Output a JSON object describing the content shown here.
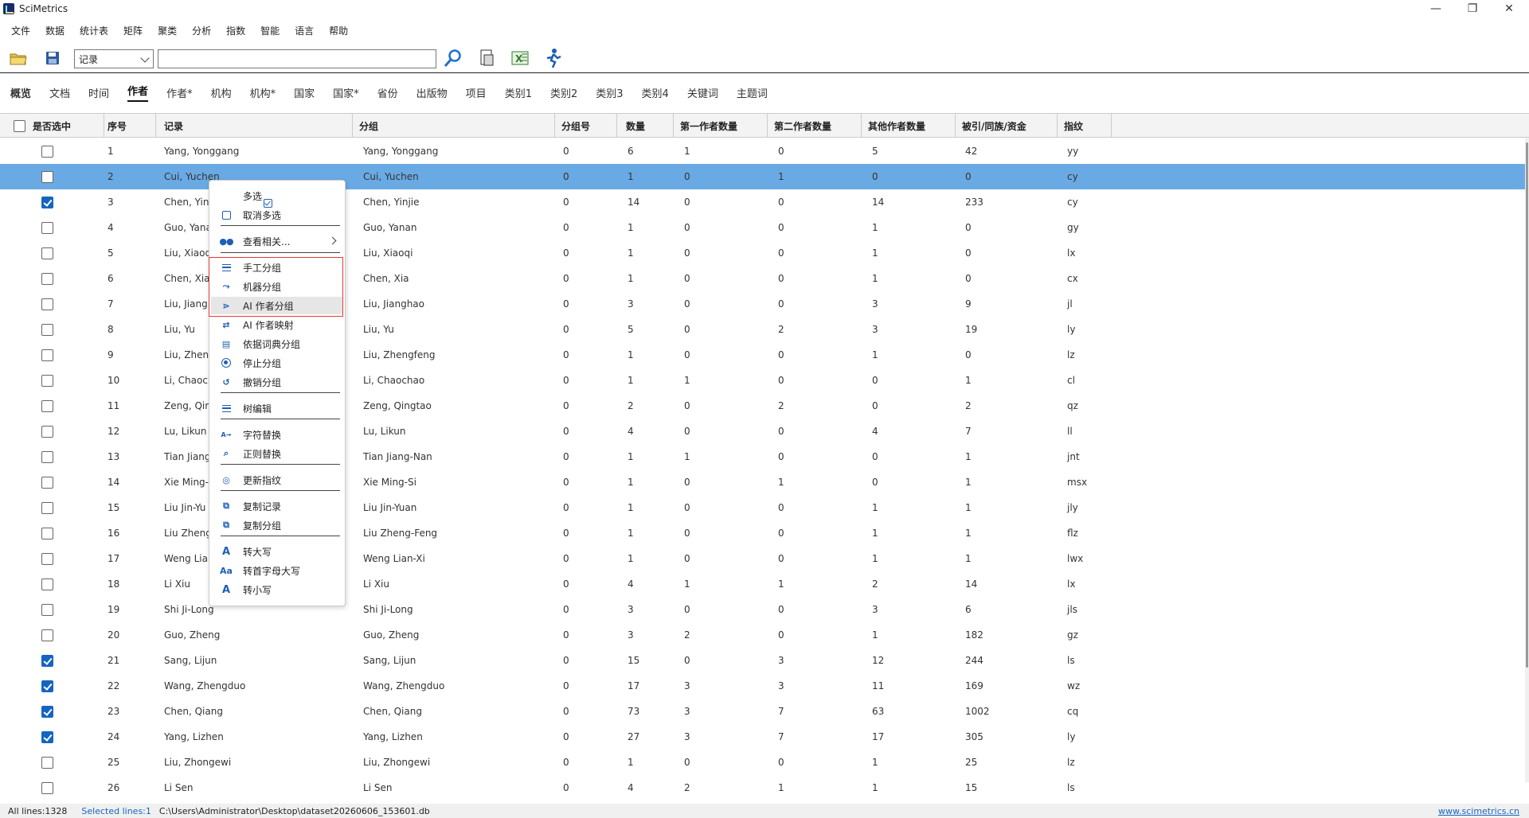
{
  "app": {
    "title": "SciMetrics"
  },
  "window_controls": {
    "minimize": "—",
    "maximize": "❐",
    "close": "✕"
  },
  "menu": [
    "文件",
    "数据",
    "统计表",
    "矩阵",
    "聚类",
    "分析",
    "指数",
    "智能",
    "语言",
    "帮助"
  ],
  "toolbar": {
    "combo_value": "记录",
    "search_value": ""
  },
  "tabs": [
    {
      "label": "概览",
      "style": "bold"
    },
    {
      "label": "文档"
    },
    {
      "label": "时间"
    },
    {
      "label": "作者",
      "style": "active"
    },
    {
      "label": "作者*"
    },
    {
      "label": "机构"
    },
    {
      "label": "机构*"
    },
    {
      "label": "国家"
    },
    {
      "label": "国家*"
    },
    {
      "label": "省份"
    },
    {
      "label": "出版物"
    },
    {
      "label": "项目"
    },
    {
      "label": "类别1"
    },
    {
      "label": "类别2"
    },
    {
      "label": "类别3"
    },
    {
      "label": "类别4"
    },
    {
      "label": "关键词"
    },
    {
      "label": "主题词"
    }
  ],
  "table": {
    "columns": [
      "是否选中",
      "序号",
      "记录",
      "分组",
      "分组号",
      "数量",
      "第一作者数量",
      "第二作者数量",
      "其他作者数量",
      "被引/同族/资金",
      "指纹"
    ],
    "rows": [
      {
        "checked": false,
        "seq": "1",
        "record": "Yang, Yonggang",
        "group": "Yang, Yonggang",
        "gid": "0",
        "count": "6",
        "first": "1",
        "second": "0",
        "other": "5",
        "cited": "42",
        "fp": "yy"
      },
      {
        "checked": false,
        "seq": "2",
        "record": "Cui, Yuchen",
        "group": "Cui, Yuchen",
        "gid": "0",
        "count": "1",
        "first": "0",
        "second": "1",
        "other": "0",
        "cited": "0",
        "fp": "cy",
        "selected": true
      },
      {
        "checked": true,
        "seq": "3",
        "record": "Chen, Yin",
        "group": "Chen, Yinjie",
        "gid": "0",
        "count": "14",
        "first": "0",
        "second": "0",
        "other": "14",
        "cited": "233",
        "fp": "cy"
      },
      {
        "checked": false,
        "seq": "4",
        "record": "Guo, Yana",
        "group": "Guo, Yanan",
        "gid": "0",
        "count": "1",
        "first": "0",
        "second": "0",
        "other": "1",
        "cited": "0",
        "fp": "gy"
      },
      {
        "checked": false,
        "seq": "5",
        "record": "Liu, Xiaoq",
        "group": "Liu, Xiaoqi",
        "gid": "0",
        "count": "1",
        "first": "0",
        "second": "0",
        "other": "1",
        "cited": "0",
        "fp": "lx"
      },
      {
        "checked": false,
        "seq": "6",
        "record": "Chen, Xia",
        "group": "Chen, Xia",
        "gid": "0",
        "count": "1",
        "first": "0",
        "second": "0",
        "other": "1",
        "cited": "0",
        "fp": "cx"
      },
      {
        "checked": false,
        "seq": "7",
        "record": "Liu, Jiang",
        "group": "Liu, Jianghao",
        "gid": "0",
        "count": "3",
        "first": "0",
        "second": "0",
        "other": "3",
        "cited": "9",
        "fp": "jl"
      },
      {
        "checked": false,
        "seq": "8",
        "record": "Liu, Yu",
        "group": "Liu, Yu",
        "gid": "0",
        "count": "5",
        "first": "0",
        "second": "2",
        "other": "3",
        "cited": "19",
        "fp": "ly"
      },
      {
        "checked": false,
        "seq": "9",
        "record": "Liu, Zheng",
        "group": "Liu, Zhengfeng",
        "gid": "0",
        "count": "1",
        "first": "0",
        "second": "0",
        "other": "1",
        "cited": "0",
        "fp": "lz"
      },
      {
        "checked": false,
        "seq": "10",
        "record": "Li, Chaoch",
        "group": "Li, Chaochao",
        "gid": "0",
        "count": "1",
        "first": "1",
        "second": "0",
        "other": "0",
        "cited": "1",
        "fp": "cl"
      },
      {
        "checked": false,
        "seq": "11",
        "record": "Zeng, Qin",
        "group": "Zeng, Qingtao",
        "gid": "0",
        "count": "2",
        "first": "0",
        "second": "2",
        "other": "0",
        "cited": "2",
        "fp": "qz"
      },
      {
        "checked": false,
        "seq": "12",
        "record": "Lu, Likun",
        "group": "Lu, Likun",
        "gid": "0",
        "count": "4",
        "first": "0",
        "second": "0",
        "other": "4",
        "cited": "7",
        "fp": "ll"
      },
      {
        "checked": false,
        "seq": "13",
        "record": "Tian Jiang",
        "group": "Tian Jiang-Nan",
        "gid": "0",
        "count": "1",
        "first": "1",
        "second": "0",
        "other": "0",
        "cited": "1",
        "fp": "jnt"
      },
      {
        "checked": false,
        "seq": "14",
        "record": "Xie Ming-",
        "group": "Xie Ming-Si",
        "gid": "0",
        "count": "1",
        "first": "0",
        "second": "1",
        "other": "0",
        "cited": "1",
        "fp": "msx"
      },
      {
        "checked": false,
        "seq": "15",
        "record": "Liu Jin-Yu",
        "group": "Liu Jin-Yuan",
        "gid": "0",
        "count": "1",
        "first": "0",
        "second": "0",
        "other": "1",
        "cited": "1",
        "fp": "jly"
      },
      {
        "checked": false,
        "seq": "16",
        "record": "Liu Zheng",
        "group": "Liu Zheng-Feng",
        "gid": "0",
        "count": "1",
        "first": "0",
        "second": "0",
        "other": "1",
        "cited": "1",
        "fp": "flz"
      },
      {
        "checked": false,
        "seq": "17",
        "record": "Weng Lian",
        "group": "Weng Lian-Xi",
        "gid": "0",
        "count": "1",
        "first": "0",
        "second": "0",
        "other": "1",
        "cited": "1",
        "fp": "lwx"
      },
      {
        "checked": false,
        "seq": "18",
        "record": "Li Xiu",
        "group": "Li Xiu",
        "gid": "0",
        "count": "4",
        "first": "1",
        "second": "1",
        "other": "2",
        "cited": "14",
        "fp": "lx"
      },
      {
        "checked": false,
        "seq": "19",
        "record": "Shi Ji-Long",
        "group": "Shi Ji-Long",
        "gid": "0",
        "count": "3",
        "first": "0",
        "second": "0",
        "other": "3",
        "cited": "6",
        "fp": "jls"
      },
      {
        "checked": false,
        "seq": "20",
        "record": "Guo, Zheng",
        "group": "Guo, Zheng",
        "gid": "0",
        "count": "3",
        "first": "2",
        "second": "0",
        "other": "1",
        "cited": "182",
        "fp": "gz"
      },
      {
        "checked": true,
        "seq": "21",
        "record": "Sang, Lijun",
        "group": "Sang, Lijun",
        "gid": "0",
        "count": "15",
        "first": "0",
        "second": "3",
        "other": "12",
        "cited": "244",
        "fp": "ls"
      },
      {
        "checked": true,
        "seq": "22",
        "record": "Wang, Zhengduo",
        "group": "Wang, Zhengduo",
        "gid": "0",
        "count": "17",
        "first": "3",
        "second": "3",
        "other": "11",
        "cited": "169",
        "fp": "wz"
      },
      {
        "checked": true,
        "seq": "23",
        "record": "Chen, Qiang",
        "group": "Chen, Qiang",
        "gid": "0",
        "count": "73",
        "first": "3",
        "second": "7",
        "other": "63",
        "cited": "1002",
        "fp": "cq"
      },
      {
        "checked": true,
        "seq": "24",
        "record": "Yang, Lizhen",
        "group": "Yang, Lizhen",
        "gid": "0",
        "count": "27",
        "first": "3",
        "second": "7",
        "other": "17",
        "cited": "305",
        "fp": "ly"
      },
      {
        "checked": false,
        "seq": "25",
        "record": "Liu, Zhongewi",
        "group": "Liu, Zhongewi",
        "gid": "0",
        "count": "1",
        "first": "0",
        "second": "0",
        "other": "1",
        "cited": "25",
        "fp": "lz"
      },
      {
        "checked": false,
        "seq": "26",
        "record": "Li Sen",
        "group": "Li Sen",
        "gid": "0",
        "count": "4",
        "first": "2",
        "second": "1",
        "other": "1",
        "cited": "15",
        "fp": "ls"
      }
    ]
  },
  "context_menu": {
    "items": [
      {
        "label": "多选",
        "icon": "checked-box-icon"
      },
      {
        "label": "取消多选",
        "icon": "empty-box-icon"
      },
      {
        "label": "查看相关...",
        "icon": "dots-icon",
        "submenu": true
      },
      {
        "label": "手工分组",
        "icon": "list-icon"
      },
      {
        "label": "机器分组",
        "icon": "machine-icon"
      },
      {
        "label": "AI 作者分组",
        "icon": "ai-group-icon",
        "highlighted": true
      },
      {
        "label": "AI 作者映射",
        "icon": "ai-map-icon"
      },
      {
        "label": "依据词典分组",
        "icon": "dictionary-icon"
      },
      {
        "label": "停止分组",
        "icon": "stop-icon"
      },
      {
        "label": "撤销分组",
        "icon": "undo-icon"
      },
      {
        "label": "树编辑",
        "icon": "tree-icon"
      },
      {
        "label": "字符替换",
        "icon": "replace-icon"
      },
      {
        "label": "正则替换",
        "icon": "regex-search-icon"
      },
      {
        "label": "更新指纹",
        "icon": "fingerprint-icon"
      },
      {
        "label": "复制记录",
        "icon": "copy-icon"
      },
      {
        "label": "复制分组",
        "icon": "copy-group-icon"
      },
      {
        "label": "转大写",
        "icon": "uppercase-icon"
      },
      {
        "label": "转首字母大写",
        "icon": "capitalize-icon"
      },
      {
        "label": "转小写",
        "icon": "lowercase-icon"
      }
    ]
  },
  "status": {
    "all_lines": "All lines:1328",
    "selected_lines": "Selected lines:1",
    "path": "C:\\Users\\Administrator\\Desktop\\dataset20260606_153601.db",
    "website": "www.scimetrics.cn"
  }
}
